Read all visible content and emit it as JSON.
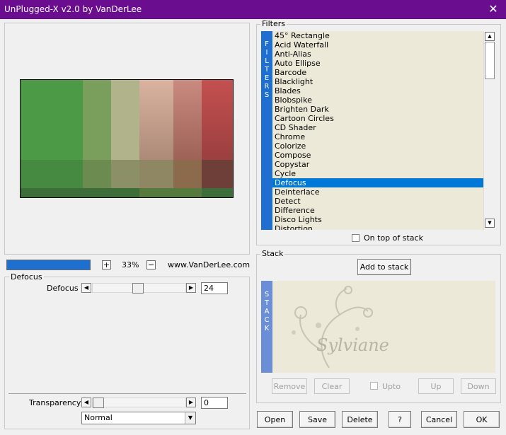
{
  "window": {
    "title": "UnPlugged-X v2.0 by VanDerLee",
    "close": "✕"
  },
  "preview": {
    "zoom": "33%",
    "zoom_in": "+",
    "zoom_out": "−",
    "website": "www.VanDerLee.com",
    "progress": 1.0
  },
  "params": {
    "group_title": "Defocus",
    "defocus_label": "Defocus",
    "defocus_value": "24",
    "transparency_label": "Transparency",
    "transparency_value": "0",
    "blend_mode": "Normal"
  },
  "filters": {
    "group_title": "Filters",
    "vertical_label": "FILTERS",
    "items": [
      "45° Rectangle",
      "Acid Waterfall",
      "Anti-Alias",
      "Auto Ellipse",
      "Barcode",
      "Blacklight",
      "Blades",
      "Blobspike",
      "Brighten Dark",
      "Cartoon Circles",
      "CD Shader",
      "Chrome",
      "Colorize",
      "Compose",
      "Copystar",
      "Cycle",
      "Defocus",
      "Deinterlace",
      "Detect",
      "Difference",
      "Disco Lights",
      "Distortion"
    ],
    "selected": "Defocus",
    "on_top_label": "On top of stack"
  },
  "stack": {
    "group_title": "Stack",
    "vertical_label": "STACK",
    "add_label": "Add to stack",
    "watermark": "Sylviane",
    "remove": "Remove",
    "clear": "Clear",
    "upto": "Upto",
    "up": "Up",
    "down": "Down"
  },
  "footer": {
    "open": "Open",
    "save": "Save",
    "delete": "Delete",
    "help": "?",
    "cancel": "Cancel",
    "ok": "OK"
  },
  "colors": {
    "title_bar": "#6a0d8f",
    "selection": "#0078d7",
    "side_strip": "#1f6fd1"
  }
}
